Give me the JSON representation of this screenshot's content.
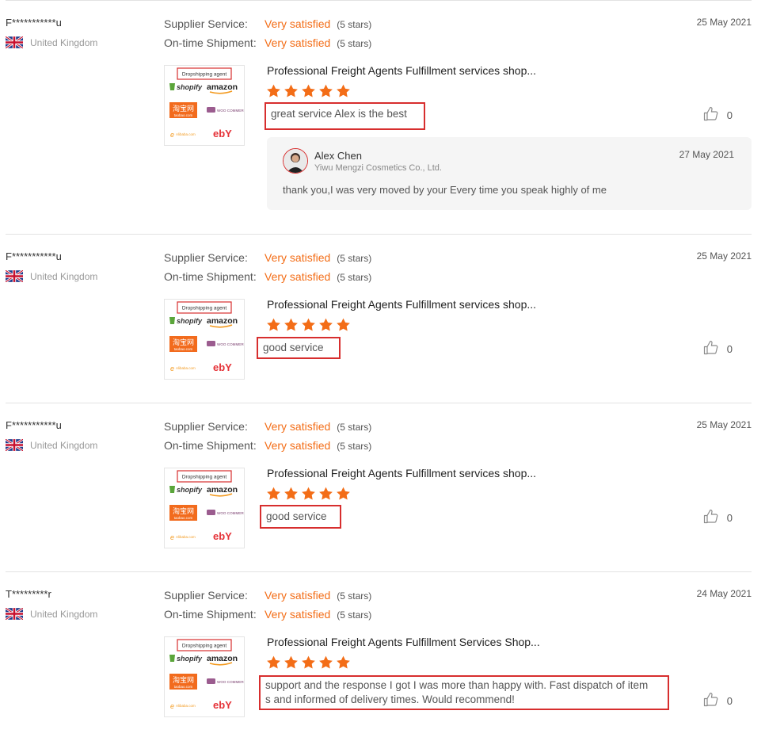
{
  "labels": {
    "supplier_service": "Supplier Service:",
    "ontime_shipment": "On-time Shipment:"
  },
  "colors": {
    "accent_orange": "#f36d17",
    "highlight_red": "#d72e2e"
  },
  "icons": {
    "flag": "uk-flag-icon",
    "like": "thumbs-up-icon",
    "star": "star-icon"
  },
  "product_image": {
    "badge": "Dropshipping agent",
    "logos": [
      "shopify",
      "amazon",
      "淘宝网",
      "taobao.com",
      "WOO COMMERCE",
      "Alibaba.com",
      "ebY"
    ]
  },
  "reviews": [
    {
      "buyer": "F***********u",
      "country": "United Kingdom",
      "date": "25 May 2021",
      "supplier_rating": "Very satisfied",
      "supplier_stars": "(5 stars)",
      "shipment_rating": "Very satisfied",
      "shipment_stars": "(5 stars)",
      "product_title": "Professional Freight Agents Fulfillment services shop...",
      "product_stars": 5,
      "comment": "great service Alex is the best",
      "likes": "0",
      "reply": {
        "name": "Alex Chen",
        "company": "Yiwu Mengzi Cosmetics Co., Ltd.",
        "date": "27 May 2021",
        "text": "thank you,I was very moved by your Every time you speak highly of me"
      }
    },
    {
      "buyer": "F***********u",
      "country": "United Kingdom",
      "date": "25 May 2021",
      "supplier_rating": "Very satisfied",
      "supplier_stars": "(5 stars)",
      "shipment_rating": "Very satisfied",
      "shipment_stars": "(5 stars)",
      "product_title": "Professional Freight Agents Fulfillment services shop...",
      "product_stars": 5,
      "comment": "good service",
      "likes": "0"
    },
    {
      "buyer": "F***********u",
      "country": "United Kingdom",
      "date": "25 May 2021",
      "supplier_rating": "Very satisfied",
      "supplier_stars": "(5 stars)",
      "shipment_rating": "Very satisfied",
      "shipment_stars": "(5 stars)",
      "product_title": "Professional Freight Agents Fulfillment services shop...",
      "product_stars": 5,
      "comment": "good service",
      "likes": "0"
    },
    {
      "buyer": "T*********r",
      "country": "United Kingdom",
      "date": "24 May 2021",
      "supplier_rating": "Very satisfied",
      "supplier_stars": "(5 stars)",
      "shipment_rating": "Very satisfied",
      "shipment_stars": "(5 stars)",
      "product_title": "Professional Freight Agents Fulfillment Services Shop...",
      "product_stars": 5,
      "comment_lines": [
        "support and the response I got I was more than happy with. Fast dispatch of item",
        "s and informed of delivery times. Would recommend!"
      ],
      "likes": "0"
    }
  ]
}
